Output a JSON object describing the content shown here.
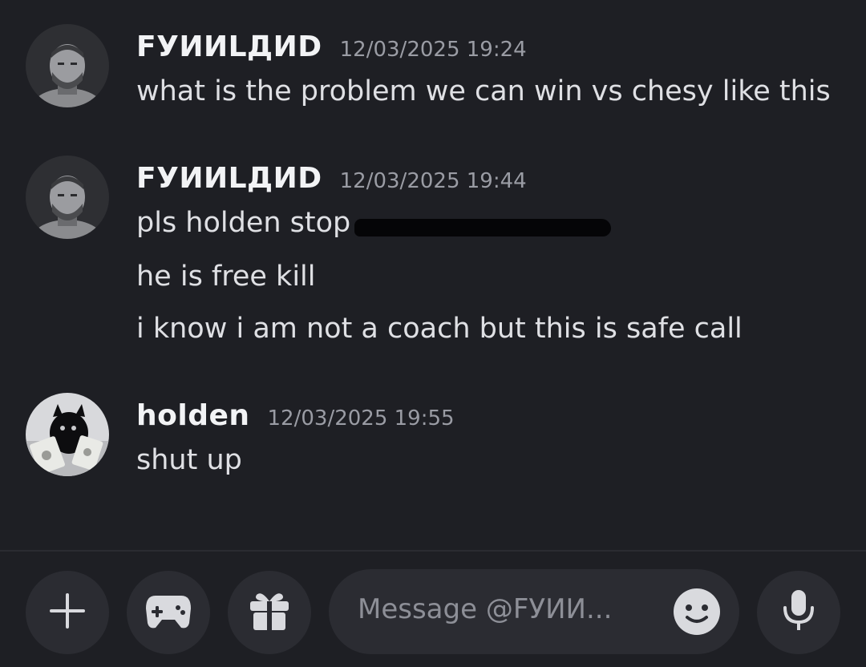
{
  "messages": [
    {
      "author": "FУИИLДИD",
      "timestamp": "12/03/2025 19:24",
      "lines": [
        "what is the problem we can win vs chesy like this"
      ]
    },
    {
      "author": "FУИИLДИD",
      "timestamp": "12/03/2025 19:44",
      "lines": [
        "pls holden stop",
        "he is free kill",
        "i know i am not a coach but this is safe call"
      ]
    },
    {
      "author": "holden",
      "timestamp": "12/03/2025 19:55",
      "lines": [
        "shut up"
      ]
    }
  ],
  "composer": {
    "placeholder": "Message @FУИИ..."
  },
  "icons": {
    "add": "plus-icon",
    "activities": "gamepad-icon",
    "gift": "gift-icon",
    "emoji": "smiley-icon",
    "voice": "microphone-icon"
  },
  "colors": {
    "background": "#1e1f24",
    "button_background": "#2b2c32",
    "text": "#dfe0e4",
    "timestamp": "#9a9ca4",
    "icon": "#d9dade"
  }
}
